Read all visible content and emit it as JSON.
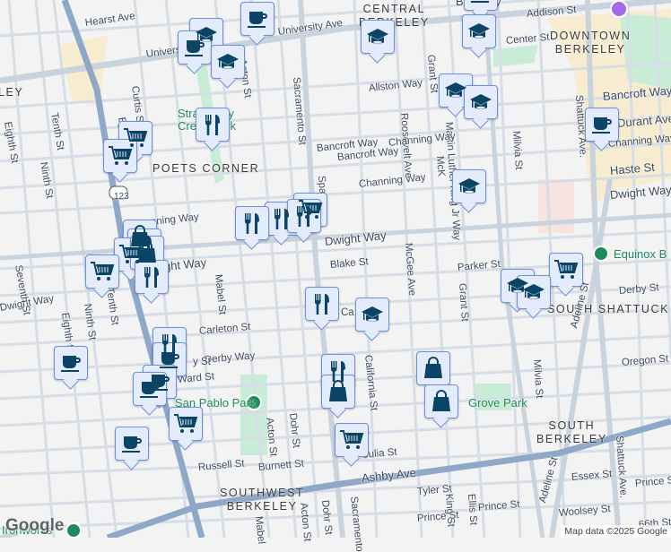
{
  "neighborhoods": {
    "central": "CENTRAL\nBERKELEY",
    "downtown": "DOWNTOWN\nBERKELEY",
    "poets": "POETS CORNER",
    "south_shattuck": "SOUTH SHATTUCK",
    "south": "SOUTH\nBERKELEY",
    "southwest": "SOUTHWEST\nBERKELEY",
    "left_cut": "LEY",
    "top_cut": "Berkeley"
  },
  "parks": {
    "strawberry": "Strawberry Creek Park",
    "san_pablo": "San Pablo Park",
    "grove": "Grove Park",
    "equinox": "Equinox B",
    "ironworks": "Ironworks"
  },
  "streets": {
    "hearst": "Hearst Ave",
    "university1": "University Ave",
    "university2": "University Ave",
    "curtis": "Curtis St",
    "acton1": "Acton St",
    "sacramento1": "Sacramento St",
    "tenth1": "Tenth St",
    "eighth1": "Eighth St",
    "ninth1": "Ninth St",
    "byron": "By",
    "bancroft1": "Bancroft Way",
    "channing1": "Channing Way",
    "channing_l": "nning Way",
    "dwight1": "Dwight Way",
    "dwight_l": "ght Way",
    "dwight2": "Dwight Way",
    "spaulding": "Spau",
    "seventh": "Seventh St",
    "addison": "Addison St",
    "center": "Center St",
    "grant1": "Grant St",
    "allston": "Allston Way",
    "roosevelt": "Roosevelt Ave",
    "mlk1": "Martin Luther King Jr Way",
    "milvia1": "Milvia St",
    "bancroft2": "Bancroft Way",
    "bancroft3": "Bancroft Way",
    "durant": "Durant Ave",
    "channing2": "Channing Way",
    "channing3": "Channing Way",
    "haste": "Haste St",
    "dwight3": "Dwight Way",
    "shattuck1": "Shattuck Ave.",
    "mckinley": "McK",
    "blake": "Blake St",
    "mcgee": "McGee Ave",
    "parker": "Parker St",
    "grant2": "Grant St",
    "derby": "Derby St",
    "mabel1": "Mabel St",
    "carleton": "Carleton St",
    "carleton2": "Ca",
    "derby_l": "Derby Way",
    "parker_l": "y St",
    "ward": "Ward St",
    "california": "California St",
    "milvia2": "Milvia St",
    "adeline1": "Adeline St",
    "oregon": "Oregon St",
    "russell": "Russell St",
    "burnett": "Burnett St",
    "acton2": "Acton St",
    "dohr1": "Dohr St",
    "julia": "Julia St",
    "ashby": "Ashby Ave",
    "tyler": "Tyler St",
    "king": "King St",
    "ellis": "Ellis St",
    "prince1": "Prince St",
    "prince2": "Prince St",
    "prince3": "Prince St",
    "essex": "Essex St",
    "woolsey": "Woolsey St",
    "adeline2": "Adeline St",
    "shattuck2": "Shattuck Ave.",
    "sixtysixth": "66th St",
    "mabel2": "Mabel",
    "acton3": "Acton St",
    "dohr2": "Dohr St",
    "sacramento2": "Sacramento",
    "eighth2": "Eighth St",
    "ninth2": "Ninth St",
    "tenth2": "Tenth St",
    "route": "123"
  },
  "footer": {
    "google": "Google",
    "attribution": "Map data ©2025 Google"
  },
  "colors": {
    "marker_bg": "#e4ecfc",
    "marker_border": "#6b92dc",
    "icon": "#0b4566",
    "highway": "#8fa8c8",
    "park": "#1e8a5a"
  }
}
